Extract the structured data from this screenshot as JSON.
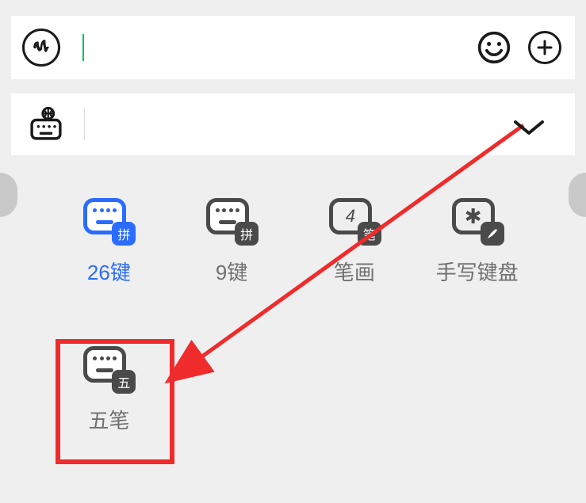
{
  "inputBar": {
    "voiceIcon": "voice-icon",
    "inputValue": "",
    "emojiIcon": "emoji-icon",
    "plusIcon": "plus-icon"
  },
  "imeBar": {
    "switchIcon": "ime-switch-icon",
    "collapseIcon": "chevron-down-icon"
  },
  "options": [
    {
      "id": "26key",
      "label": "26键",
      "badge": "拼",
      "active": true,
      "type": "kb"
    },
    {
      "id": "9key",
      "label": "9键",
      "badge": "拼",
      "active": false,
      "type": "kb"
    },
    {
      "id": "bihua",
      "label": "笔画",
      "badge": "笔",
      "active": false,
      "type": "bihua",
      "glyph": "4"
    },
    {
      "id": "handwriting",
      "label": "手写键盘",
      "badge": "",
      "active": false,
      "type": "hand",
      "glyph": "✱",
      "subglyph": "✎"
    },
    {
      "id": "wubi",
      "label": "五笔",
      "badge": "五",
      "active": false,
      "type": "kb"
    }
  ],
  "annotation": {
    "highlightTarget": "wubi",
    "arrowColor": "#ef2b2b"
  }
}
